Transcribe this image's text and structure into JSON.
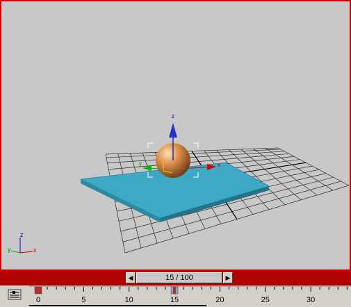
{
  "viewport": {
    "border_color": "#cc0000",
    "background": "#c8c8c8",
    "axis_labels": {
      "x": "x",
      "y": "y",
      "z": "z"
    }
  },
  "time_slider": {
    "label": "15 / 100",
    "current_frame": 15,
    "total_frames": 100,
    "prev_icon": "left-arrow-icon",
    "next_icon": "right-arrow-icon"
  },
  "track_bar": {
    "icon": "track-bar-toggle-icon",
    "tick_labels": [
      "0",
      "5",
      "10",
      "15",
      "20",
      "25",
      "30"
    ],
    "current_frame": 15,
    "keyframes": [
      0,
      15
    ]
  },
  "objects": {
    "sphere_color": "#d88a45",
    "box_color": "#3ea9c4"
  }
}
